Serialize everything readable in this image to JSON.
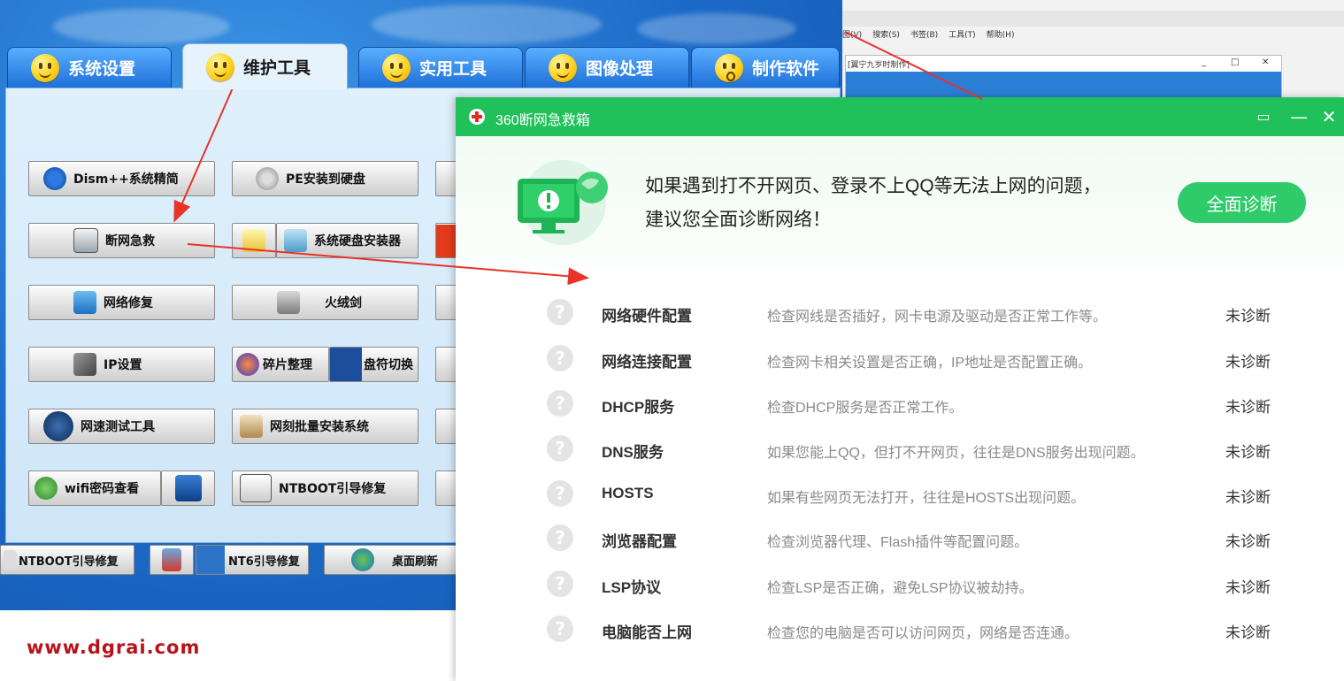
{
  "tool_window": {
    "tabs": [
      {
        "label": "系统设置",
        "icon": "smile-face-icon"
      },
      {
        "label": "维护工具",
        "icon": "tongue-face-icon"
      },
      {
        "label": "实用工具",
        "icon": "smile-face-icon"
      },
      {
        "label": "图像处理",
        "icon": "confused-face-icon"
      },
      {
        "label": "制作软件",
        "icon": "surprised-face-icon"
      }
    ],
    "buttons": {
      "dism": "Dism++系统精简",
      "pe_install": "PE安装到硬盘",
      "net_rescue": "断网急救",
      "disk_installer": "系统硬盘安装器",
      "net_repair": "网络修复",
      "huorong": "火绒剑",
      "ip_settings": "IP设置",
      "defrag": "碎片整理",
      "drive_letter": "盘符切换",
      "speed_test": "网速测试工具",
      "batch_install": "网刻批量安装系统",
      "wifi_password": "wifi密码查看",
      "ntboot_repair": "NTBOOT引导修复"
    },
    "bottom_bar": {
      "ntboot": "NTBOOT引导修复",
      "nt6": "NT6引导修复",
      "refresh": "桌面刷新"
    }
  },
  "browser": {
    "menu": [
      "图(V)",
      "搜索(S)",
      "书签(B)",
      "工具(T)",
      "帮助(H)"
    ],
    "subwindow_title": "[翼宁九岁时制作]"
  },
  "dialog": {
    "title": "360断网急救箱",
    "hero_line1": "如果遇到打不开网页、登录不上QQ等无法上网的问题，",
    "hero_line2": "建议您全面诊断网络！",
    "diagnose_button": "全面诊断",
    "accent": "#20c05b",
    "items": [
      {
        "name": "网络硬件配置",
        "desc": "检查网线是否插好，网卡电源及驱动是否正常工作等。",
        "status": "未诊断"
      },
      {
        "name": "网络连接配置",
        "desc": "检查网卡相关设置是否正确，IP地址是否配置正确。",
        "status": "未诊断"
      },
      {
        "name": "DHCP服务",
        "desc": "检查DHCP服务是否正常工作。",
        "status": "未诊断"
      },
      {
        "name": "DNS服务",
        "desc": "如果您能上QQ，但打不开网页，往往是DNS服务出现问题。",
        "status": "未诊断"
      },
      {
        "name": "HOSTS",
        "desc": "如果有些网页无法打开，往往是HOSTS出现问题。",
        "status": "未诊断"
      },
      {
        "name": "浏览器配置",
        "desc": "检查浏览器代理、Flash插件等配置问题。",
        "status": "未诊断"
      },
      {
        "name": "LSP协议",
        "desc": "检查LSP是否正确，避免LSP协议被劫持。",
        "status": "未诊断"
      },
      {
        "name": "电脑能否上网",
        "desc": "检查您的电脑是否可以访问网页，网络是否连通。",
        "status": "未诊断"
      }
    ]
  },
  "watermark": "www.dgrai.com"
}
